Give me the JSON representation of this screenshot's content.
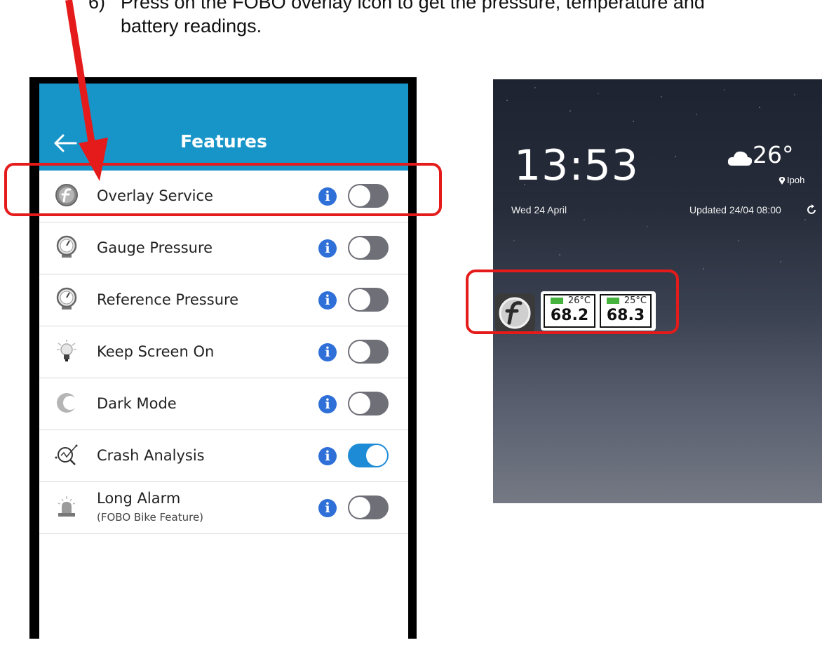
{
  "instruction": {
    "number": "6)",
    "line1": "Press on the FOBO overlay icon to get the pressure, temperature and",
    "line2": "battery readings."
  },
  "features_screen": {
    "title": "Features",
    "back_icon": "arrow-left-icon",
    "info_icon": "info-icon",
    "colors": {
      "appbar": "#1795c8",
      "toggle_on": "#1e8bd6",
      "toggle_off": "#6e6f77",
      "info": "#2e6fd8"
    },
    "items": [
      {
        "label": "Overlay Service",
        "icon": "fobo-logo-icon",
        "enabled": false
      },
      {
        "label": "Gauge Pressure",
        "icon": "pressure-gauge-icon",
        "enabled": false
      },
      {
        "label": "Reference Pressure",
        "icon": "pressure-gauge-icon",
        "enabled": false
      },
      {
        "label": "Keep Screen On",
        "icon": "lightbulb-icon",
        "enabled": false
      },
      {
        "label": "Dark Mode",
        "icon": "moon-icon",
        "enabled": false
      },
      {
        "label": "Crash Analysis",
        "icon": "magnifier-graph-icon",
        "enabled": true
      },
      {
        "label": "Long Alarm",
        "sublabel": "(FOBO Bike Feature)",
        "icon": "siren-icon",
        "enabled": false
      }
    ]
  },
  "home_screen": {
    "time": "13:53",
    "date": "Wed 24 April",
    "weather_icon": "cloud-icon",
    "temperature": "26°",
    "location": "Ipoh",
    "updated": "Updated 24/04 08:00",
    "refresh_icon": "refresh-icon",
    "overlay": {
      "app_icon": "fobo-app-icon",
      "readings": [
        {
          "temp": "26°C",
          "value": "68.2"
        },
        {
          "temp": "25°C",
          "value": "68.3"
        }
      ]
    }
  },
  "annotation_color": "#e51b1b"
}
